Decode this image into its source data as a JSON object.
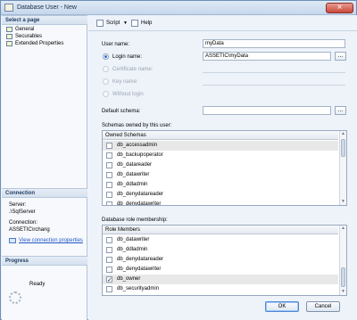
{
  "window": {
    "title": "Database User - New",
    "close_glyph": "×"
  },
  "left_nav": {
    "select_page_header": "Select a page",
    "pages": [
      "General",
      "Securables",
      "Extended Properties"
    ]
  },
  "connection": {
    "header": "Connection",
    "server_label": "Server:",
    "server_value": ".\\SqlServer",
    "connection_label": "Connection:",
    "connection_value": "ASSETIC\\rchang",
    "view_properties_link": "View connection properties"
  },
  "progress": {
    "header": "Progress",
    "status": "Ready"
  },
  "toolbar": {
    "script_label": "Script",
    "script_dropdown_glyph": "▼",
    "help_label": "Help"
  },
  "form": {
    "user_name_label": "User name:",
    "user_name_value": "myData",
    "login_name_label": "Login name:",
    "login_name_value": "ASSETIC\\myData",
    "certificate_name_label": "Certificate name:",
    "key_name_label": "Key name:",
    "without_login_label": "Without login",
    "default_schema_label": "Default schema:",
    "default_schema_value": "",
    "browse_glyph": "..."
  },
  "owned_schemas": {
    "section_label": "Schemas owned by this user:",
    "column_header": "Owned Schemas",
    "rows": [
      {
        "name": "db_accessadmin",
        "checked": false,
        "highlighted": true
      },
      {
        "name": "db_backupoperator",
        "checked": false,
        "highlighted": false
      },
      {
        "name": "db_datareader",
        "checked": false,
        "highlighted": false
      },
      {
        "name": "db_datawriter",
        "checked": false,
        "highlighted": false
      },
      {
        "name": "db_ddladmin",
        "checked": false,
        "highlighted": false
      },
      {
        "name": "db_denydatareader",
        "checked": false,
        "highlighted": false
      },
      {
        "name": "db_denydatawriter",
        "checked": false,
        "highlighted": false
      }
    ]
  },
  "role_membership": {
    "section_label": "Database role membership:",
    "column_header": "Role Members",
    "rows": [
      {
        "name": "db_datawriter",
        "checked": false,
        "highlighted": false
      },
      {
        "name": "db_ddladmin",
        "checked": false,
        "highlighted": false
      },
      {
        "name": "db_denydatareader",
        "checked": false,
        "highlighted": false
      },
      {
        "name": "db_denydatawriter",
        "checked": false,
        "highlighted": false
      },
      {
        "name": "db_owner",
        "checked": true,
        "highlighted": true
      },
      {
        "name": "db_securityadmin",
        "checked": false,
        "highlighted": false
      }
    ]
  },
  "buttons": {
    "ok": "OK",
    "cancel": "Cancel"
  }
}
